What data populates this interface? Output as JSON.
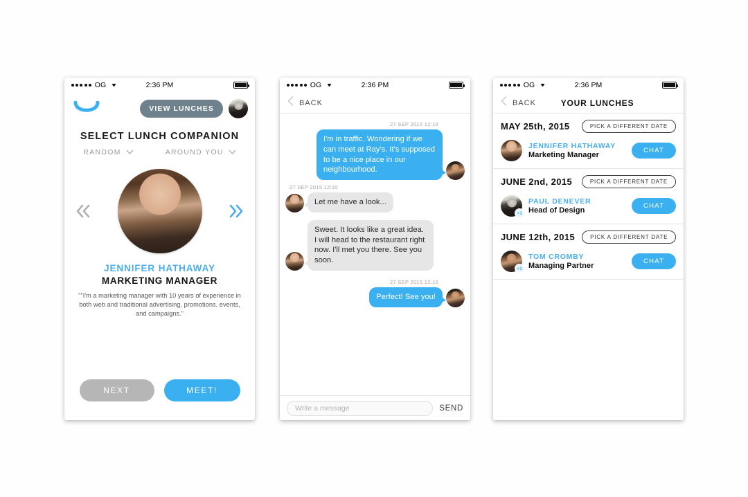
{
  "status_bar": {
    "signal_dots": 5,
    "carrier": "OG",
    "wifi_icon": "wifi-icon",
    "time": "2:36 PM",
    "battery_icon": "battery-full-icon"
  },
  "colors": {
    "accent_blue": "#3bb0f0",
    "name_blue": "#4aadef",
    "slate_button": "#6f818c",
    "next_gray": "#b6b6b6",
    "bubble_gray": "#e6e6e6"
  },
  "screen1": {
    "logo_icon": "smile-arc-logo",
    "view_lunches_label": "VIEW LUNCHES",
    "header_avatar": "user-avatar",
    "title": "SELECT LUNCH COMPANION",
    "filters": [
      {
        "label": "RANDOM",
        "icon": "chevron-down-icon"
      },
      {
        "label": "AROUND YOU",
        "icon": "chevron-down-icon"
      }
    ],
    "prev_icon": "double-chevron-left-icon",
    "next_icon": "double-chevron-right-icon",
    "profile": {
      "avatar": "jennifer-hathaway-avatar",
      "name": "JENNIFER HATHAWAY",
      "role": "MARKETING MANAGER",
      "bio": "\"\"I'm a marketing manager with 10 years of experience in both web and traditional advertising, promotions, events, and campaigns.\""
    },
    "next_label": "NEXT",
    "meet_label": "MEET!"
  },
  "screen2": {
    "back_label": "BACK",
    "back_icon": "chevron-left-icon",
    "messages": [
      {
        "side": "out",
        "timestamp": "27 SEP 2015 12:10",
        "text": "I'm in traffic. Wondering if we can meet at Ray's. It's supposed to be a nice place in our neighbourhood.",
        "avatar": "self-avatar"
      },
      {
        "side": "in",
        "timestamp": "27 SEP 2015 12:10",
        "text": "Let me have a look...",
        "avatar": "jennifer-hathaway-avatar"
      },
      {
        "side": "in",
        "timestamp": "",
        "text": "Sweet. It looks like a great idea. I will head to the restaurant right now. I'll met you there. See you soon.",
        "avatar": "jennifer-hathaway-avatar"
      },
      {
        "side": "out",
        "timestamp": "27 SEP 2015 12:10",
        "text": "Perfect! See you!",
        "avatar": "self-avatar"
      }
    ],
    "input_placeholder": "Write a message",
    "input_value": "",
    "send_label": "SEND"
  },
  "screen3": {
    "back_label": "BACK",
    "back_icon": "chevron-left-icon",
    "title": "YOUR LUNCHES",
    "groups": [
      {
        "date": "MAY 25th, 2015",
        "pick_date_label": "PICK A DIFFERENT DATE",
        "person": {
          "avatar": "jennifer-hathaway-avatar",
          "name": "JENNIFER HATHAWAY",
          "role": "Marketing Manager",
          "extra_badge": "",
          "chat_label": "CHAT"
        }
      },
      {
        "date": "JUNE 2nd, 2015",
        "pick_date_label": "PICK A DIFFERENT DATE",
        "person": {
          "avatar": "paul-denever-avatar",
          "name": "PAUL DENEVER",
          "role": "Head of Design",
          "extra_badge": "+1",
          "chat_label": "CHAT"
        }
      },
      {
        "date": "JUNE 12th, 2015",
        "pick_date_label": "PICK A DIFFERENT DATE",
        "person": {
          "avatar": "tom-cromby-avatar",
          "name": "TOM CROMBY",
          "role": "Managing Partner",
          "extra_badge": "+1",
          "chat_label": "CHAT"
        }
      }
    ]
  }
}
